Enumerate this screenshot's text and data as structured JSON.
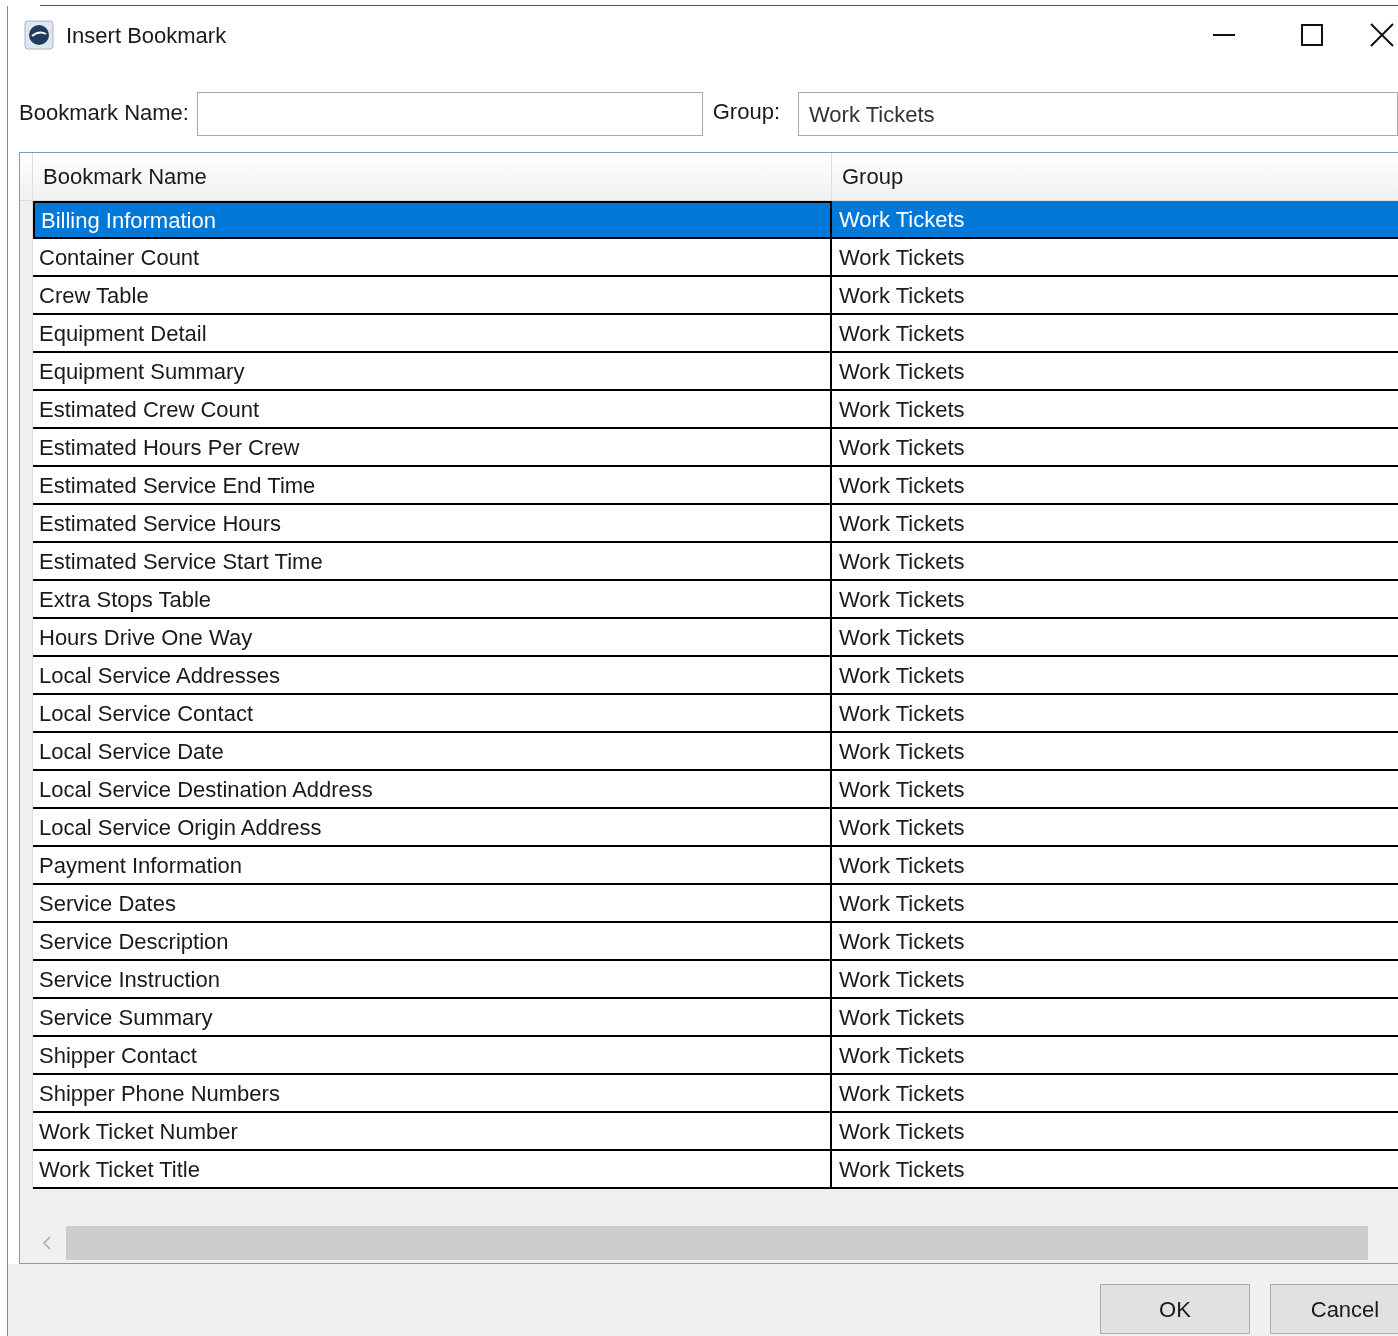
{
  "window": {
    "title": "Insert Bookmark"
  },
  "form": {
    "name_label": "Bookmark Name:",
    "group_label": "Group:",
    "group_value": "Work Tickets"
  },
  "table": {
    "columns": [
      "Bookmark Name",
      "Group"
    ],
    "rows": [
      {
        "name": "Billing Information",
        "group": "Work Tickets",
        "selected": true
      },
      {
        "name": "Container Count",
        "group": "Work Tickets",
        "selected": false
      },
      {
        "name": "Crew Table",
        "group": "Work Tickets",
        "selected": false
      },
      {
        "name": "Equipment Detail",
        "group": "Work Tickets",
        "selected": false
      },
      {
        "name": "Equipment Summary",
        "group": "Work Tickets",
        "selected": false
      },
      {
        "name": "Estimated Crew Count",
        "group": "Work Tickets",
        "selected": false
      },
      {
        "name": "Estimated Hours Per Crew",
        "group": "Work Tickets",
        "selected": false
      },
      {
        "name": "Estimated Service End Time",
        "group": "Work Tickets",
        "selected": false
      },
      {
        "name": "Estimated Service Hours",
        "group": "Work Tickets",
        "selected": false
      },
      {
        "name": "Estimated Service Start Time",
        "group": "Work Tickets",
        "selected": false
      },
      {
        "name": "Extra Stops Table",
        "group": "Work Tickets",
        "selected": false
      },
      {
        "name": "Hours Drive One Way",
        "group": "Work Tickets",
        "selected": false
      },
      {
        "name": "Local Service Addresses",
        "group": "Work Tickets",
        "selected": false
      },
      {
        "name": "Local Service Contact",
        "group": "Work Tickets",
        "selected": false
      },
      {
        "name": "Local Service Date",
        "group": "Work Tickets",
        "selected": false
      },
      {
        "name": "Local Service Destination Address",
        "group": "Work Tickets",
        "selected": false
      },
      {
        "name": "Local Service Origin Address",
        "group": "Work Tickets",
        "selected": false
      },
      {
        "name": "Payment Information",
        "group": "Work Tickets",
        "selected": false
      },
      {
        "name": "Service Dates",
        "group": "Work Tickets",
        "selected": false
      },
      {
        "name": "Service Description",
        "group": "Work Tickets",
        "selected": false
      },
      {
        "name": "Service Instruction",
        "group": "Work Tickets",
        "selected": false
      },
      {
        "name": "Service Summary",
        "group": "Work Tickets",
        "selected": false
      },
      {
        "name": "Shipper Contact",
        "group": "Work Tickets",
        "selected": false
      },
      {
        "name": "Shipper Phone Numbers",
        "group": "Work Tickets",
        "selected": false
      },
      {
        "name": "Work Ticket Number",
        "group": "Work Tickets",
        "selected": false
      },
      {
        "name": "Work Ticket Title",
        "group": "Work Tickets",
        "selected": false
      }
    ]
  },
  "buttons": [
    "OK",
    "Cancel"
  ]
}
